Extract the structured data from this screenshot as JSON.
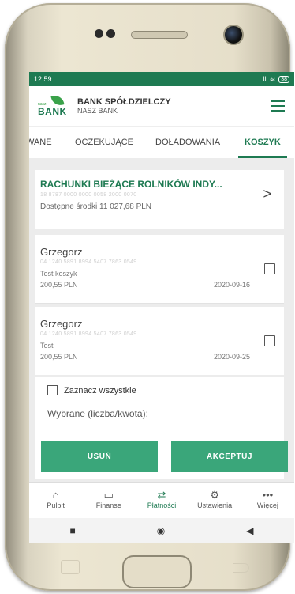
{
  "status": {
    "time": "12:59",
    "battery": "38",
    "signal": "..ll"
  },
  "header": {
    "logo_small": "nasz",
    "logo_big": "BANK",
    "bank_line1": "BANK SPÓŁDZIELCZY",
    "bank_line2": "NASZ BANK"
  },
  "tabs": [
    {
      "label": "WANE"
    },
    {
      "label": "OCZEKUJĄCE"
    },
    {
      "label": "DOŁADOWANIA"
    },
    {
      "label": "KOSZYK"
    }
  ],
  "account": {
    "title": "RACHUNKI BIEŻĄCE ROLNIKÓW INDY...",
    "number": "18 8787 0000 0000 0058 2000 0070",
    "available": "Dostępne środki 11 027,68 PLN"
  },
  "items": [
    {
      "name": "Grzegorz",
      "account": "04 1240 5891 8994 5407 7863 0549",
      "desc": "Test koszyk",
      "amount": "200,55 PLN",
      "date": "2020-09-16"
    },
    {
      "name": "Grzegorz",
      "account": "04 1240 5891 8994 5407 7863 0549",
      "desc": "Test",
      "amount": "200,55 PLN",
      "date": "2020-09-25"
    }
  ],
  "select_all_label": "Zaznacz wszystkie",
  "chosen_label": "Wybrane (liczba/kwota):",
  "buttons": {
    "delete": "USUŃ",
    "accept": "AKCEPTUJ"
  },
  "bottom_nav": [
    {
      "label": "Pulpit",
      "icon": "home-icon"
    },
    {
      "label": "Finanse",
      "icon": "wallet-icon"
    },
    {
      "label": "Płatności",
      "icon": "transfer-icon"
    },
    {
      "label": "Ustawienia",
      "icon": "gear-icon"
    },
    {
      "label": "Więcej",
      "icon": "more-icon"
    }
  ],
  "colors": {
    "primary": "#1e7a52",
    "button": "#3aa67a",
    "background": "#ececec"
  }
}
